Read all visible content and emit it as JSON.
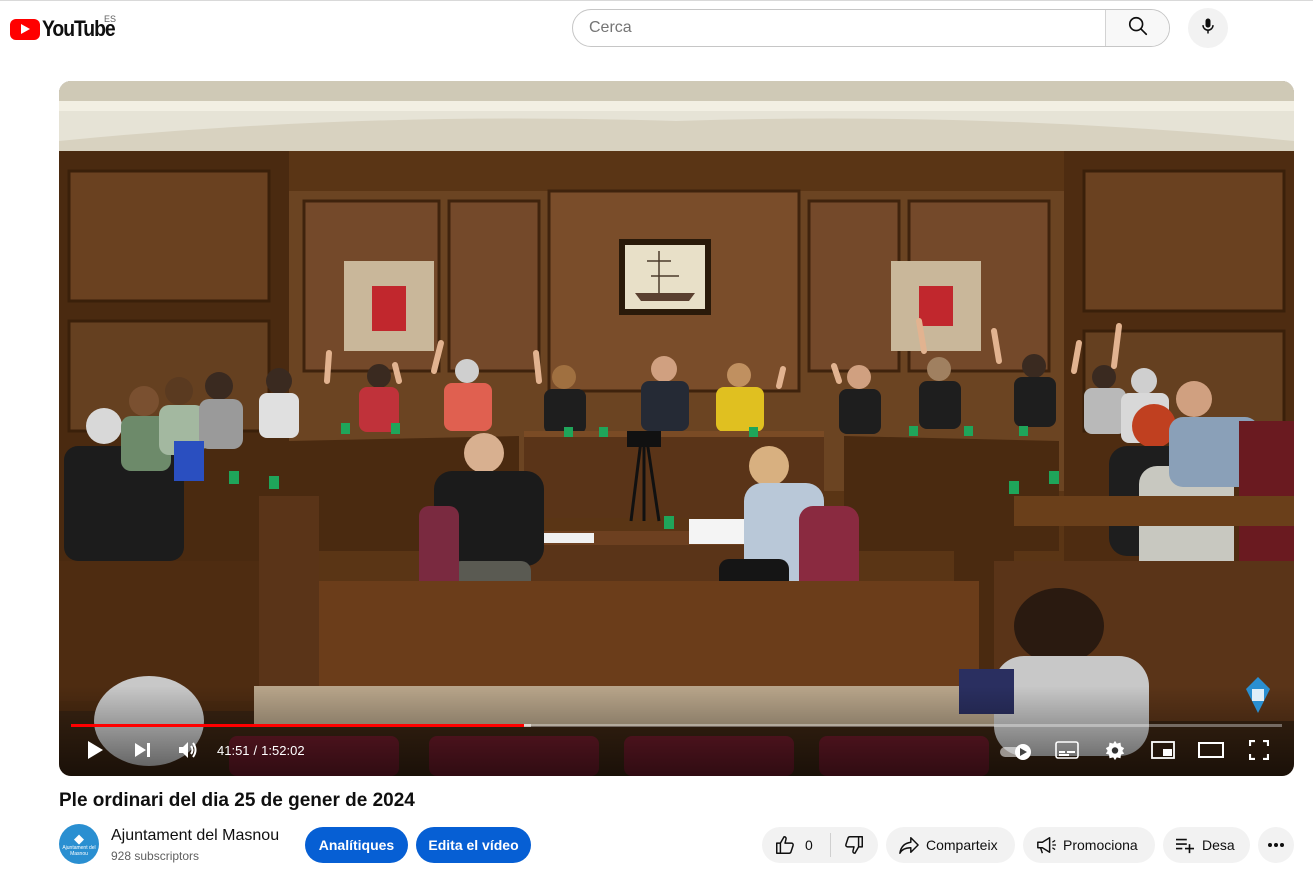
{
  "header": {
    "logo_text": "YouTube",
    "country_code": "ES",
    "search": {
      "placeholder": "Cerca",
      "value": ""
    },
    "icons": [
      "youtube-logo-icon",
      "search-icon",
      "microphone-icon"
    ]
  },
  "player": {
    "current_time": "41:51",
    "separator": "/",
    "duration": "1:52:02",
    "progress_played_fraction": 0.374,
    "progress_buffered_fraction": 0.38,
    "autoplay": "on",
    "controls": [
      "play-icon",
      "next-icon",
      "volume-icon",
      "autoplay-toggle",
      "subtitles-icon",
      "settings-gear-icon",
      "miniplayer-icon",
      "theater-mode-icon",
      "fullscreen-icon"
    ],
    "colors": {
      "progress": "#ff0000",
      "accent": "#065fd4"
    }
  },
  "video": {
    "title": "Ple ordinari del dia 25 de gener de 2024"
  },
  "channel": {
    "name": "Ajuntament del Masnou",
    "subscribers": "928 subscriptors",
    "avatar_text": "Ajuntament del Masnou"
  },
  "actions": {
    "analytics_label": "Analítiques",
    "edit_label": "Edita el vídeo",
    "likes": "0",
    "share_label": "Comparteix",
    "promote_label": "Promociona",
    "save_label": "Desa"
  }
}
